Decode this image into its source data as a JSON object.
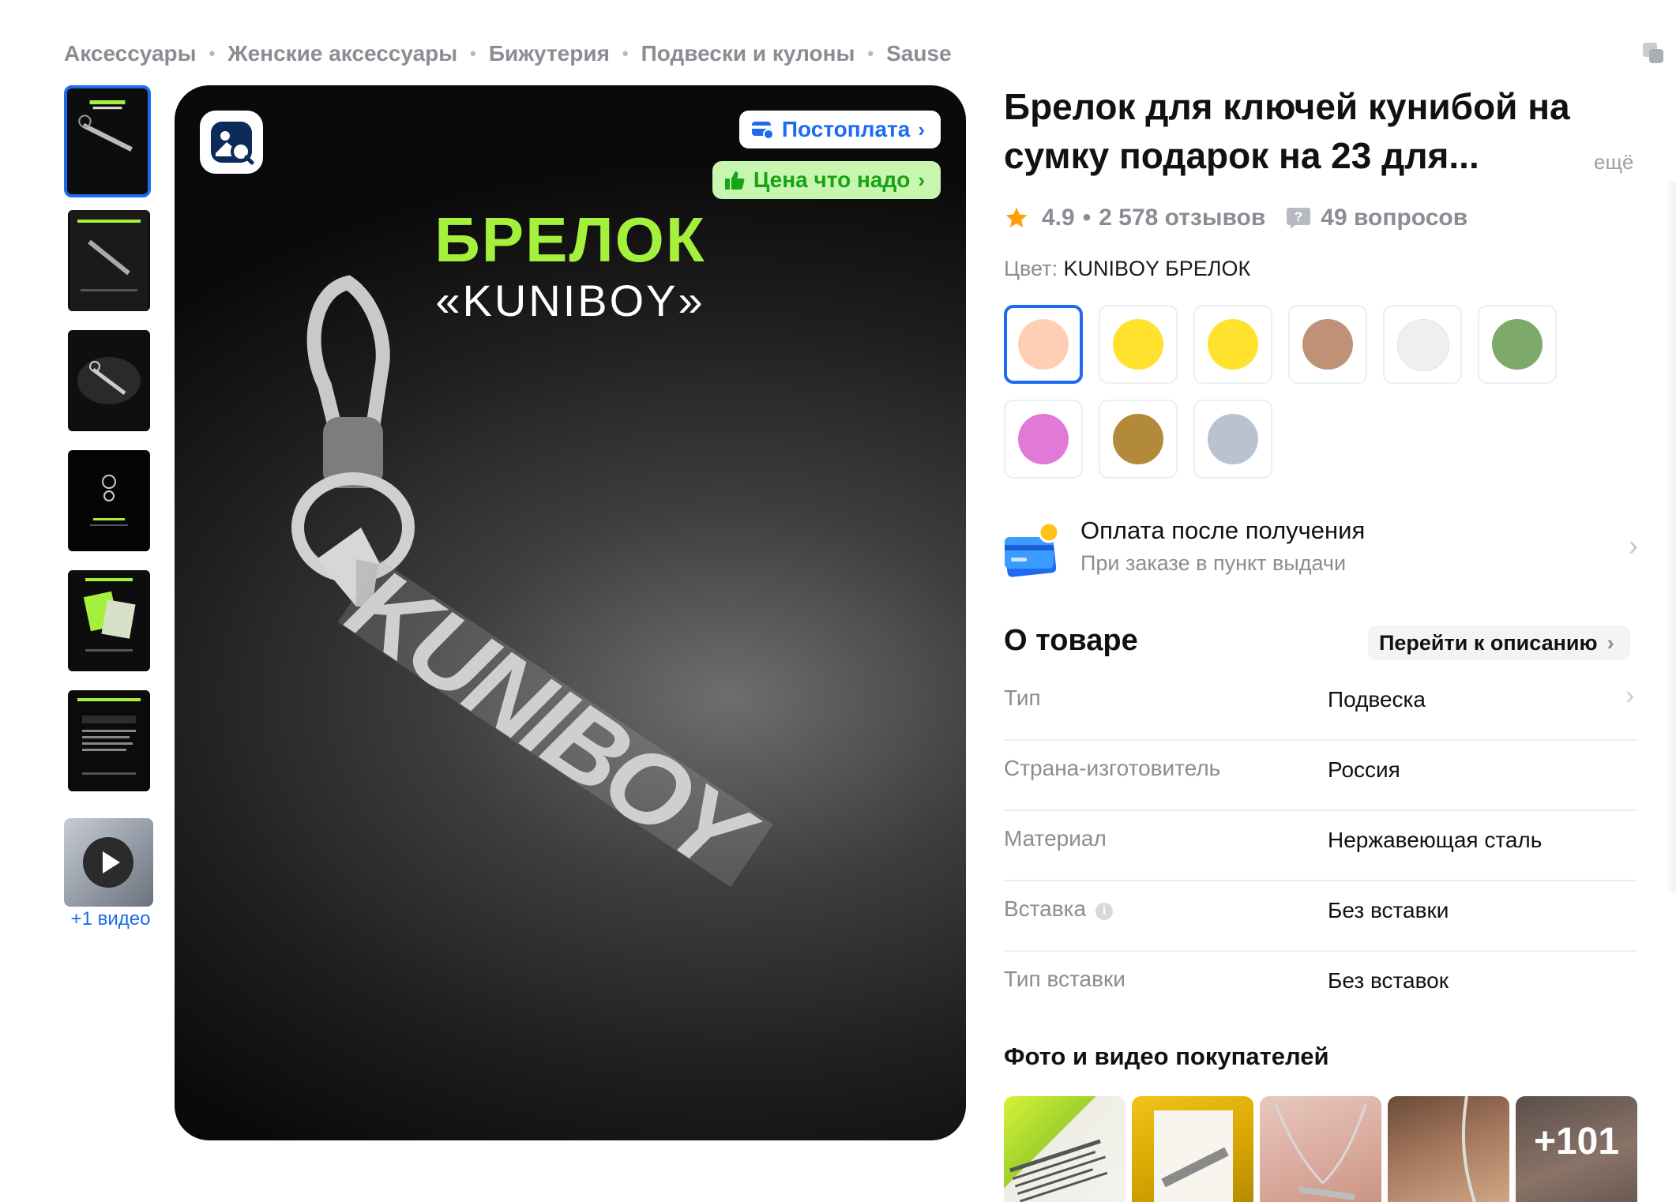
{
  "breadcrumbs": [
    "Аксессуары",
    "Женские аксессуары",
    "Бижутерия",
    "Подвески и кулоны",
    "Sause"
  ],
  "breadcrumb_separator": "•",
  "gallery": {
    "video_caption": "+1 видео",
    "main_title": "БРЕЛОК",
    "main_subtitle": "«KUNIBOY»",
    "main_engraving": "KUNIBOY",
    "badge_postpay": "Постоплата",
    "badge_price": "Цена что надо",
    "thumbnail_count": 6
  },
  "product": {
    "title": "Брелок для ключей кунибой на сумку подарок на 23 для...",
    "more_label": "ещё",
    "rating": "4.9",
    "reviews": "2 578 отзывов",
    "questions": "49 вопросов",
    "color_label": "Цвет:",
    "color_value": "KUNIBOY БРЕЛОК"
  },
  "swatches": [
    {
      "color": "#ffcfb3",
      "selected": true
    },
    {
      "color": "#ffe22e"
    },
    {
      "color": "#ffe22e"
    },
    {
      "color": "#c09077"
    },
    {
      "color": "#efefef"
    },
    {
      "color": "#7daa6b"
    },
    {
      "color": "#e07ad6"
    },
    {
      "color": "#b38a3a"
    },
    {
      "color": "#b9c3d0"
    }
  ],
  "payment": {
    "title": "Оплата после получения",
    "subtitle": "При заказе в пункт выдачи"
  },
  "about": {
    "heading": "О товаре",
    "to_description": "Перейти к описанию",
    "specs": [
      {
        "key": "Тип",
        "value": "Подвеска",
        "link": true
      },
      {
        "key": "Страна-изготовитель",
        "value": "Россия"
      },
      {
        "key": "Материал",
        "value": "Нержавеющая сталь"
      },
      {
        "key": "Вставка",
        "value": "Без вставки",
        "info": true
      },
      {
        "key": "Тип вставки",
        "value": "Без вставок"
      }
    ]
  },
  "customer_media": {
    "heading": "Фото и видео покупателей",
    "more_count": "+101"
  },
  "colors": {
    "accent": "#1e6bf0",
    "price_green": "#17a313",
    "title_green": "#a5f03c",
    "star": "#ff9f0a"
  }
}
